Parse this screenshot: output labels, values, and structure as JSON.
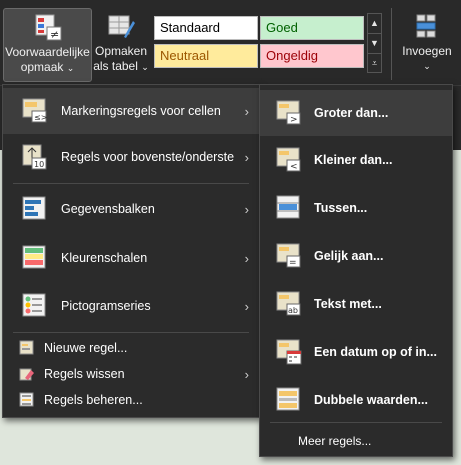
{
  "ribbon": {
    "cond_format": {
      "line1": "Voorwaardelijke",
      "line2": "opmaak"
    },
    "format_table": {
      "line1": "Opmaken",
      "line2": "als tabel"
    },
    "styles": [
      {
        "label": "Standaard",
        "bg": "#ffffff",
        "fg": "#000000"
      },
      {
        "label": "Goed",
        "bg": "#c6efce",
        "fg": "#006100"
      },
      {
        "label": "Neutraal",
        "bg": "#ffeb9c",
        "fg": "#9c5700"
      },
      {
        "label": "Ongeldig",
        "bg": "#ffc7ce",
        "fg": "#9c0006"
      }
    ],
    "insert": {
      "label": "Invoegen"
    }
  },
  "menu": {
    "items": [
      {
        "label": "Markeringsregels voor cellen",
        "icon": "highlight-rules-icon",
        "submenu": true
      },
      {
        "label": "Regels voor bovenste/onderste",
        "icon": "top-bottom-rules-icon",
        "submenu": true
      },
      {
        "label": "Gegevensbalken",
        "icon": "data-bars-icon",
        "submenu": true
      },
      {
        "label": "Kleurenschalen",
        "icon": "color-scales-icon",
        "submenu": true
      },
      {
        "label": "Pictogramseries",
        "icon": "icon-sets-icon",
        "submenu": true
      }
    ],
    "small_items": [
      {
        "label": "Nieuwe regel...",
        "icon": "new-rule-icon",
        "submenu": false
      },
      {
        "label": "Regels wissen",
        "icon": "clear-rules-icon",
        "submenu": true
      },
      {
        "label": "Regels beheren...",
        "icon": "manage-rules-icon",
        "submenu": false
      }
    ],
    "arrow": "›"
  },
  "submenu": {
    "items": [
      {
        "label": "Groter dan...",
        "icon": "greater-than-icon"
      },
      {
        "label": "Kleiner dan...",
        "icon": "less-than-icon"
      },
      {
        "label": "Tussen...",
        "icon": "between-icon"
      },
      {
        "label": "Gelijk aan...",
        "icon": "equal-to-icon"
      },
      {
        "label": "Tekst met...",
        "icon": "text-contains-icon"
      },
      {
        "label": "Een datum op of in...",
        "icon": "date-occurring-icon"
      },
      {
        "label": "Dubbele waarden...",
        "icon": "duplicate-values-icon"
      }
    ],
    "more": "Meer regels..."
  }
}
